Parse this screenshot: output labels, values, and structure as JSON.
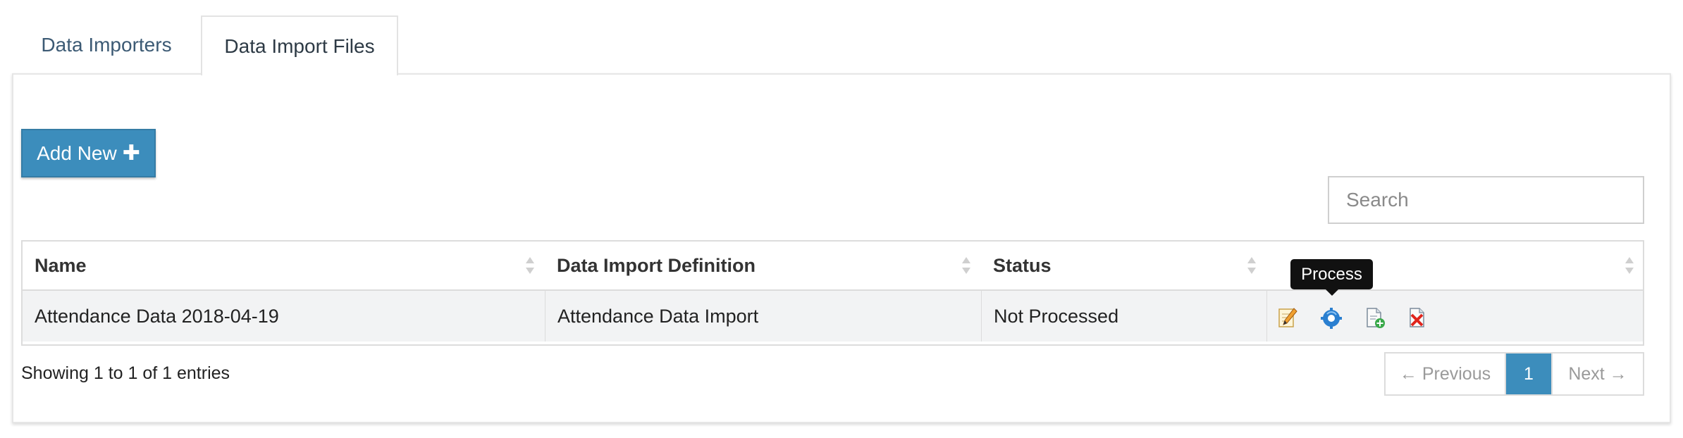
{
  "tabs": [
    {
      "label": "Data Importers"
    },
    {
      "label": "Data Import Files"
    }
  ],
  "toolbar": {
    "add_new_label": "Add New",
    "search_placeholder": "Search"
  },
  "table": {
    "columns": [
      "Name",
      "Data Import Definition",
      "Status",
      ""
    ],
    "rows": [
      {
        "name": "Attendance Data 2018-04-19",
        "definition": "Attendance Data Import",
        "status": "Not Processed",
        "actions": [
          "edit-icon",
          "process-icon",
          "add-file-icon",
          "delete-icon"
        ]
      }
    ]
  },
  "tooltip": {
    "text": "Process"
  },
  "footer": {
    "info": "Showing 1 to 1 of 1 entries",
    "pagination": {
      "previous_label": "← Previous",
      "current_page": "1",
      "next_label": "Next →"
    }
  },
  "colors": {
    "primary": "#3c8dbc",
    "row_bg": "#f2f3f4",
    "tab_text": "#3c5a74"
  }
}
